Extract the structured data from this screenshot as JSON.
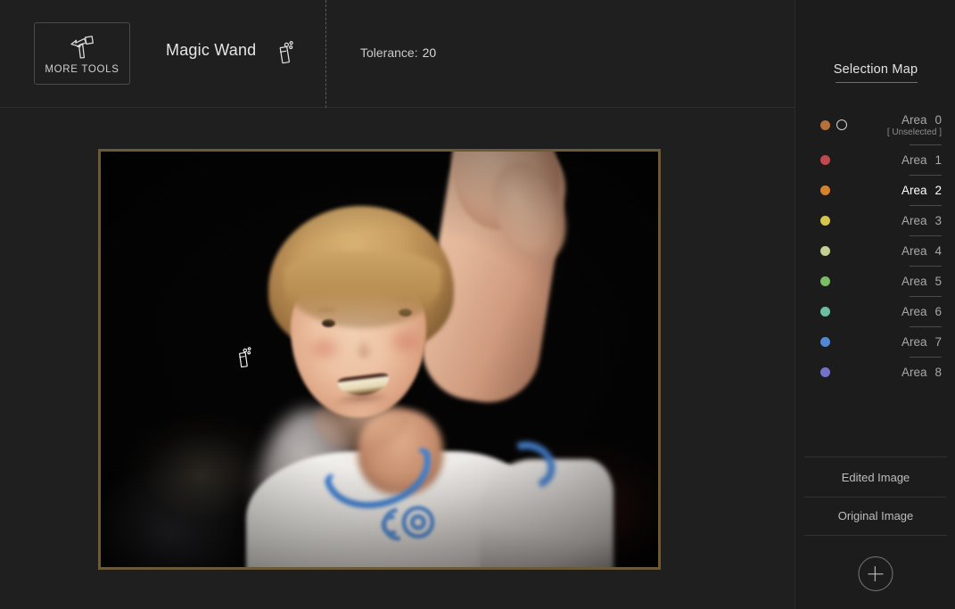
{
  "toolbar": {
    "more_tools_label": "MORE TOOLS",
    "more_tools_icon": "hammer-icon",
    "tool_title": "Magic Wand",
    "tool_title_icon": "magic-wand-icon",
    "tolerance_label": "Tolerance:",
    "tolerance_value": "20"
  },
  "canvas": {
    "cursor_icon": "magic-wand-cursor",
    "image_border_color": "#6b5a3a",
    "image_description": "Smiling blond boy clapping at a night event, dark blurred crowd behind"
  },
  "sidebar": {
    "title": "Selection Map",
    "areas": [
      {
        "label": "Area",
        "index": "0",
        "sub": "[ Unselected ]",
        "color": "#b5713a",
        "has_ring": true,
        "active": false
      },
      {
        "label": "Area",
        "index": "1",
        "sub": "",
        "color": "#c0494f",
        "has_ring": false,
        "active": false
      },
      {
        "label": "Area",
        "index": "2",
        "sub": "",
        "color": "#d3812b",
        "has_ring": false,
        "active": true
      },
      {
        "label": "Area",
        "index": "3",
        "sub": "",
        "color": "#d4c64a",
        "has_ring": false,
        "active": false
      },
      {
        "label": "Area",
        "index": "4",
        "sub": "",
        "color": "#c3d093",
        "has_ring": false,
        "active": false
      },
      {
        "label": "Area",
        "index": "5",
        "sub": "",
        "color": "#7dbc67",
        "has_ring": false,
        "active": false
      },
      {
        "label": "Area",
        "index": "6",
        "sub": "",
        "color": "#6cbda2",
        "has_ring": false,
        "active": false
      },
      {
        "label": "Area",
        "index": "7",
        "sub": "",
        "color": "#5287d4",
        "has_ring": false,
        "active": false
      },
      {
        "label": "Area",
        "index": "8",
        "sub": "",
        "color": "#7272c6",
        "has_ring": false,
        "active": false
      }
    ],
    "edited_image_label": "Edited Image",
    "original_image_label": "Original Image",
    "add_button_icon": "plus-icon"
  }
}
